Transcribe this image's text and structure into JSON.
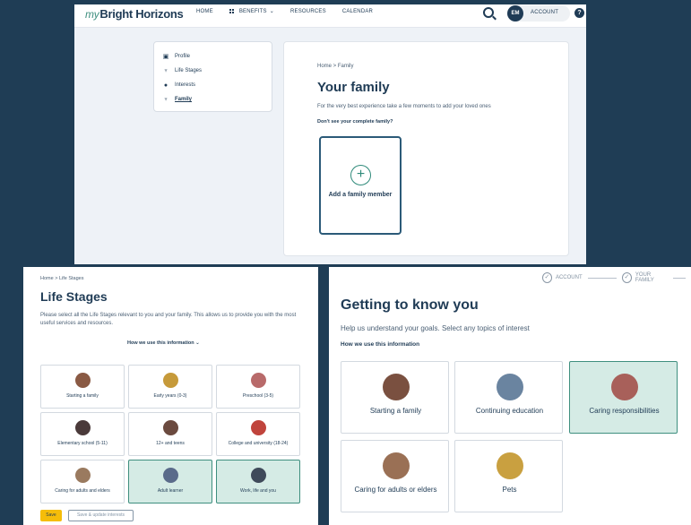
{
  "family_page": {
    "logo_prefix": "my",
    "logo_main": "Bright Horizons",
    "nav": [
      {
        "label": "HOME",
        "icon": ""
      },
      {
        "label": "BENEFITS",
        "icon": "grid-icon"
      },
      {
        "label": "RESOURCES",
        "icon": ""
      },
      {
        "label": "CALENDAR",
        "icon": ""
      }
    ],
    "avatar_initials": "EM",
    "account_label": "ACCOUNT",
    "help_glyph": "?",
    "profile_menu": [
      {
        "label": "Profile",
        "icon": "id-card-icon"
      },
      {
        "label": "Life Stages",
        "icon": "tree-icon"
      },
      {
        "label": "Interests",
        "icon": "person-icon"
      },
      {
        "label": "Family",
        "icon": "tree-icon"
      }
    ],
    "breadcrumb": "Home > Family",
    "title": "Your family",
    "subtitle": "For the very best experience take a few moments to add your loved ones",
    "missing_link": "Don't see your complete family?",
    "add_card_label": "Add a family member",
    "plus_glyph": "+"
  },
  "life_stages": {
    "breadcrumb": "Home > Life Stages",
    "title": "Life Stages",
    "description": "Please select all the Life Stages relevant to you and your family. This allows us to provide you with the most useful services and resources.",
    "how_link": "How we use this information",
    "tiles": [
      {
        "label": "Starting a family",
        "selected": false,
        "photo_color": "#8a5a44"
      },
      {
        "label": "Early years (0-3)",
        "selected": false,
        "photo_color": "#c69a3a"
      },
      {
        "label": "Preschool (3-5)",
        "selected": false,
        "photo_color": "#b86a6a"
      },
      {
        "label": "Elementary school (5-11)",
        "selected": false,
        "photo_color": "#4a3a3a"
      },
      {
        "label": "12+ and teens",
        "selected": false,
        "photo_color": "#6b4a3f"
      },
      {
        "label": "College and university (18-24)",
        "selected": false,
        "photo_color": "#c0443c"
      },
      {
        "label": "Caring for adults and elders",
        "selected": false,
        "photo_color": "#9a7a5f"
      },
      {
        "label": "Adult learner",
        "selected": true,
        "photo_color": "#5a6b8a"
      },
      {
        "label": "Work, life and you",
        "selected": true,
        "photo_color": "#3f4a5a"
      }
    ],
    "save_label": "Save",
    "update_label": "Save & update interests"
  },
  "getting_to_know": {
    "steps": [
      "ACCOUNT",
      "YOUR FAMILY"
    ],
    "check_glyph": "✓",
    "title": "Getting to know you",
    "subtitle": "Help us understand your goals. Select any topics of interest",
    "how_link": "How we use this information",
    "tiles": [
      {
        "label": "Starting a family",
        "selected": false,
        "photo_color": "#7a5040"
      },
      {
        "label": "Continuing education",
        "selected": false,
        "photo_color": "#6a84a0"
      },
      {
        "label": "Caring responsibilities",
        "selected": true,
        "photo_color": "#a8605a"
      },
      {
        "label": "Caring for adults or elders",
        "selected": false,
        "photo_color": "#9a7055"
      },
      {
        "label": "Pets",
        "selected": false,
        "photo_color": "#c9a040"
      }
    ]
  },
  "colors": {
    "background": "#1f3d55",
    "brand_navy": "#1f3b55",
    "brand_teal": "#3f8f7f",
    "selected_fill": "#d5ebe5",
    "save_yellow": "#f5bd0a"
  }
}
